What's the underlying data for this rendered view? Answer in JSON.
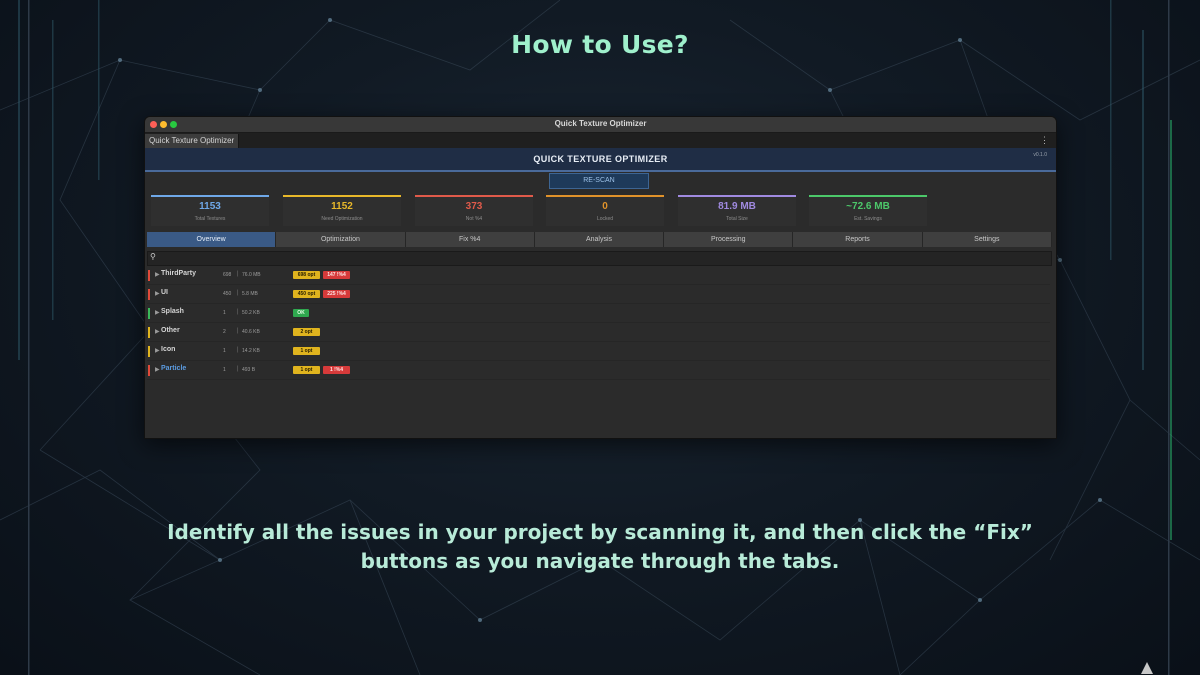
{
  "slide": {
    "headline": "How to Use?",
    "caption_line1": "Identify all the issues in your project by scanning it, and then click the “Fix”",
    "caption_line2": "buttons as you navigate through the tabs."
  },
  "window": {
    "title": "Quick Texture Optimizer",
    "doc_tab": "Quick Texture Optimizer",
    "header_title": "QUICK TEXTURE OPTIMIZER",
    "version": "v0.1.0",
    "rescan_label": "RE-SCAN"
  },
  "stats": [
    {
      "value": "1153",
      "label": "Total Textures",
      "color": "#6fa8e8"
    },
    {
      "value": "1152",
      "label": "Need Optimization",
      "color": "#e8b82a"
    },
    {
      "value": "373",
      "label": "Not %4",
      "color": "#e05a4a"
    },
    {
      "value": "0",
      "label": "Locked",
      "color": "#e0922a"
    },
    {
      "value": "81.9 MB",
      "label": "Total Size",
      "color": "#a08ae0"
    },
    {
      "value": "~72.6 MB",
      "label": "Est. Savings",
      "color": "#4cc86a"
    }
  ],
  "tabs": [
    "Overview",
    "Optimization",
    "Fix %4",
    "Analysis",
    "Processing",
    "Reports",
    "Settings"
  ],
  "search": {
    "placeholder": "",
    "value": ""
  },
  "rows": [
    {
      "name": "ThirdParty",
      "count": "698",
      "size": "76.0 MB",
      "stripe": "#e04a3a",
      "opt": "698 opt",
      "fix": "147 !%4",
      "ok": ""
    },
    {
      "name": "UI",
      "count": "450",
      "size": "5.8 MB",
      "stripe": "#e04a3a",
      "opt": "450 opt",
      "fix": "225 !%4",
      "ok": ""
    },
    {
      "name": "Splash",
      "count": "1",
      "size": "50.2 KB",
      "stripe": "#3ab85a",
      "opt": "",
      "fix": "",
      "ok": "OK"
    },
    {
      "name": "Other",
      "count": "2",
      "size": "40.6 KB",
      "stripe": "#e0b41e",
      "opt": "2 opt",
      "fix": "",
      "ok": ""
    },
    {
      "name": "Icon",
      "count": "1",
      "size": "14.2 KB",
      "stripe": "#e0b41e",
      "opt": "1 opt",
      "fix": "",
      "ok": ""
    },
    {
      "name": "Particle",
      "count": "1",
      "size": "493 B",
      "stripe": "#e04a3a",
      "opt": "1 opt",
      "fix": "1 !%4",
      "ok": "",
      "highlight": "#5b9be0"
    }
  ]
}
